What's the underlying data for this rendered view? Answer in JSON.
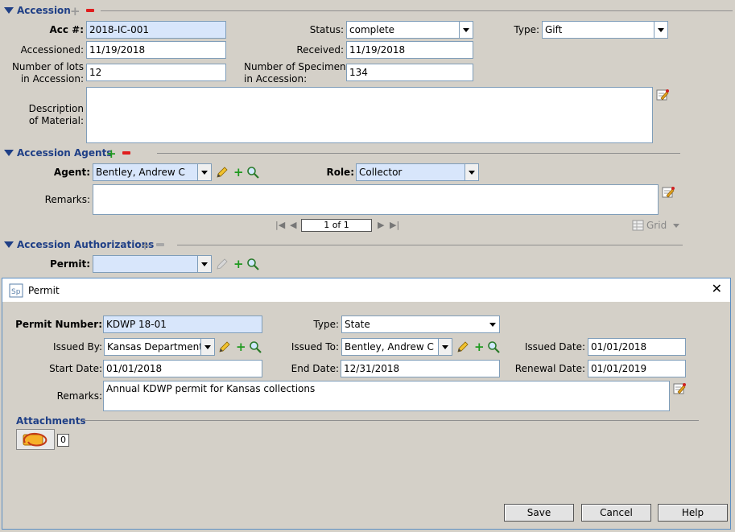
{
  "accession": {
    "title": "Accession",
    "acc_label": "Acc #:",
    "acc_value": "2018-IC-001",
    "status_label": "Status:",
    "status_value": "complete",
    "type_label": "Type:",
    "type_value": "Gift",
    "accessioned_label": "Accessioned:",
    "accessioned_value": "11/19/2018",
    "received_label": "Received:",
    "received_value": "11/19/2018",
    "lots_label_1": "Number of lots",
    "lots_label_2": "in Accession:",
    "lots_value": "12",
    "specimens_label_1": "Number of Specimens",
    "specimens_label_2": "in Accession:",
    "specimens_value": "134",
    "desc_label_1": "Description",
    "desc_label_2": "of Material:",
    "desc_value": ""
  },
  "agents": {
    "title": "Accession Agents",
    "agent_label": "Agent:",
    "agent_value": "Bentley, Andrew C",
    "role_label": "Role:",
    "role_value": "Collector",
    "remarks_label": "Remarks:",
    "remarks_value": "",
    "pager_text": "1 of 1",
    "grid_label": "Grid"
  },
  "authorizations": {
    "title": "Accession Authorizations",
    "permit_label": "Permit:",
    "permit_value": ""
  },
  "permit_dialog": {
    "title": "Permit",
    "close_glyph": "✕",
    "permit_number_label": "Permit Number:",
    "permit_number_value": "KDWP 18-01",
    "type_label": "Type:",
    "type_value": "State",
    "issued_by_label": "Issued By:",
    "issued_by_value": "Kansas Department",
    "issued_to_label": "Issued To:",
    "issued_to_value": "Bentley, Andrew C",
    "issued_date_label": "Issued Date:",
    "issued_date_value": "01/01/2018",
    "start_date_label": "Start Date:",
    "start_date_value": "01/01/2018",
    "end_date_label": "End Date:",
    "end_date_value": "12/31/2018",
    "renewal_date_label": "Renewal Date:",
    "renewal_date_value": "01/01/2019",
    "remarks_label": "Remarks:",
    "remarks_value": "Annual KDWP permit for Kansas collections",
    "attachments_title": "Attachments",
    "attachments_count": "0",
    "save_label": "Save",
    "cancel_label": "Cancel",
    "help_label": "Help"
  },
  "colors": {
    "section_title": "#1f3f86",
    "required_field": "#d8e6fb",
    "add_green": "#1f9a1f",
    "remove_red": "#e01d1d"
  },
  "icons": [
    "add-icon",
    "remove-icon",
    "edit-pencil-icon",
    "search-icon",
    "edit-form-icon",
    "first-page-icon",
    "prev-page-icon",
    "next-page-icon",
    "last-page-icon",
    "grid-icon",
    "app-logo-icon",
    "close-icon",
    "attachment-icon"
  ]
}
